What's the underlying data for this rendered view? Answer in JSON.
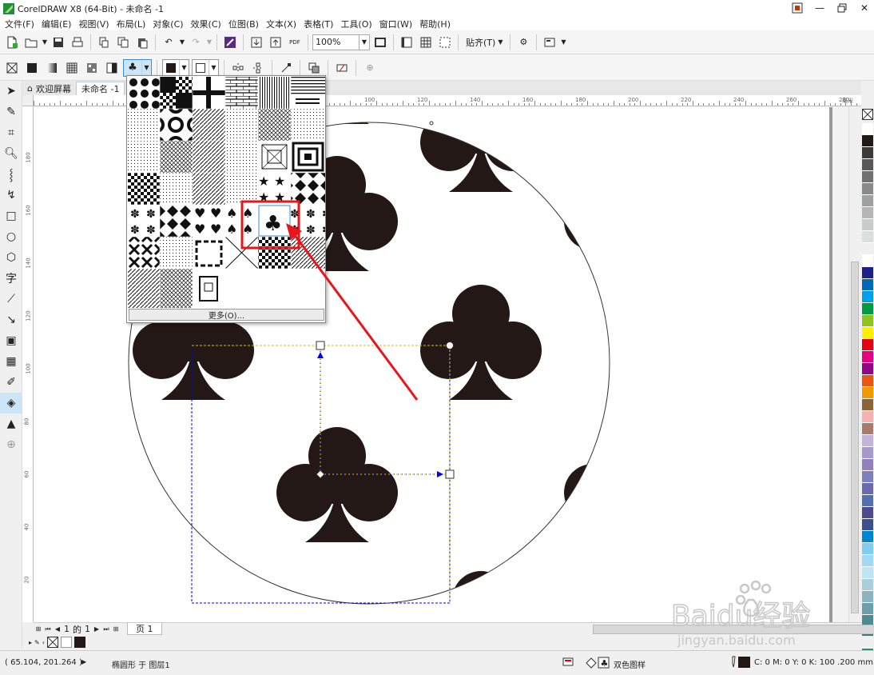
{
  "titlebar": {
    "title": "CorelDRAW X8 (64-Bit) - 未命名 -1"
  },
  "menu": [
    "文件(F)",
    "编辑(E)",
    "视图(V)",
    "布局(L)",
    "对象(C)",
    "效果(C)",
    "位图(B)",
    "文本(X)",
    "表格(T)",
    "工具(O)",
    "窗口(W)",
    "帮助(H)"
  ],
  "toolbar": {
    "zoom_value": "100%",
    "snap_label": "贴齐(T)"
  },
  "doc_tabs": {
    "welcome": "欢迎屏幕",
    "document": "未命名 -1"
  },
  "ruler": {
    "h_labels": [
      "80",
      "100",
      "120",
      "140",
      "160",
      "180",
      "200",
      "220",
      "240",
      "260",
      "280",
      "300"
    ],
    "v_labels": [
      "180",
      "160",
      "140",
      "120",
      "100",
      "80",
      "60",
      "40",
      "20"
    ],
    "unit": "毫米"
  },
  "flyout": {
    "more_label": "更多(O)..."
  },
  "page_nav": {
    "current": "1",
    "of_label": "的",
    "total": "1",
    "page_tab": "页 1"
  },
  "status": {
    "coords": "( 65.104, 201.264 )",
    "object_info": "椭圆形 于 图层1",
    "fill_label": "双色图样",
    "outline_info": "C: 0 M: 0 Y: 0 K: 100  .200 mm"
  },
  "watermark": {
    "brand": "Baidu经验",
    "url": "jingyan.baidu.com"
  },
  "palette_colors": [
    "#ffffff",
    "#231815",
    "#3e3a39",
    "#595757",
    "#727171",
    "#898989",
    "#9fa0a0",
    "#b5b5b6",
    "#c9caca",
    "#dcdddd",
    "#efefef",
    "#ffffff",
    "#1d2088",
    "#0068b7",
    "#00a0e9",
    "#009944",
    "#8fc31f",
    "#fff100",
    "#e60012",
    "#e4007f",
    "#920783",
    "#ea5514",
    "#f39800",
    "#8c6239",
    "#f5b2b2",
    "#a67c6d",
    "#c3b5d7",
    "#a59aca",
    "#8f82bc",
    "#7f7fbf",
    "#6a6aae",
    "#536eb1",
    "#4c4c8c",
    "#3c5090",
    "#0086d1",
    "#7fcdf0",
    "#9fd9f6",
    "#c0e4f2",
    "#a9cfdc",
    "#8ab4c2",
    "#6c9fab",
    "#4f8a94",
    "#3a7d7b",
    "#2f8f7a",
    "#48a088",
    "#5cad8b",
    "#7fbf9f",
    "#57b5b8"
  ],
  "colors": {
    "accent_red": "#e8161b",
    "handle_blue": "#0000ff",
    "ink": "#231815"
  }
}
